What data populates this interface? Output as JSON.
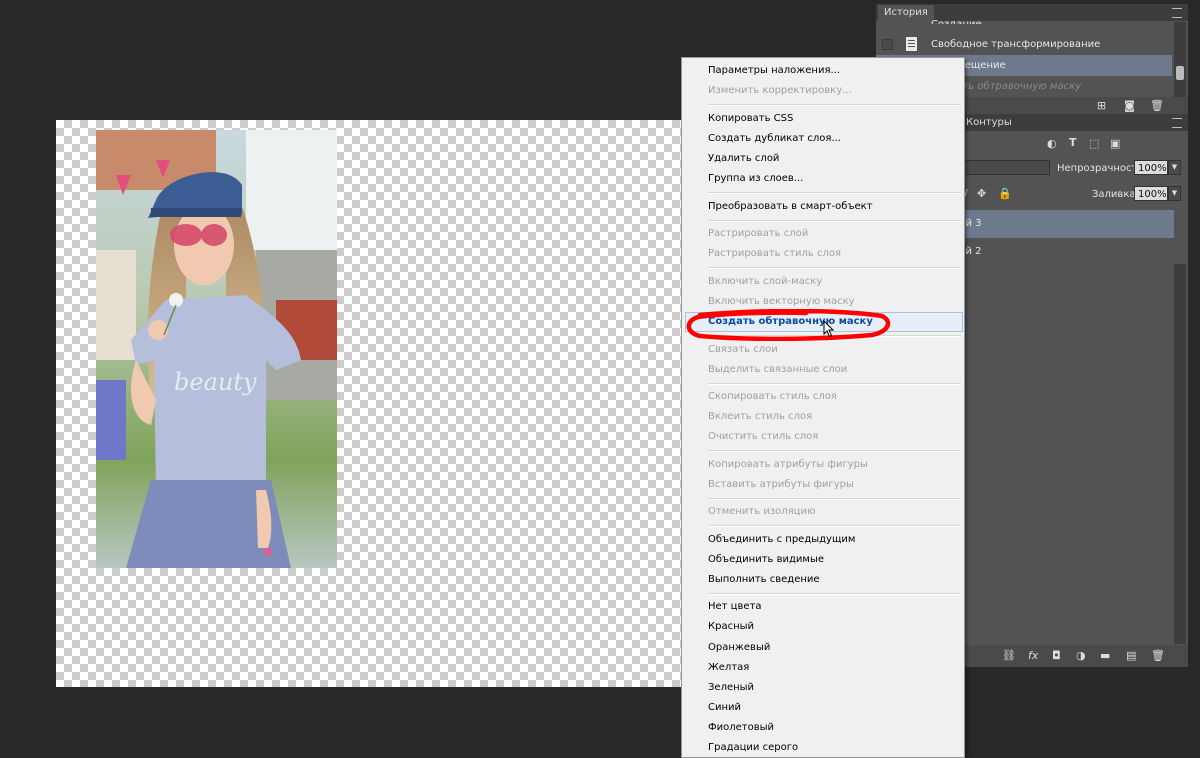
{
  "history": {
    "tab": "История",
    "rows": [
      {
        "label": "Создание"
      },
      {
        "label": "Свободное трансформирование"
      },
      {
        "label": "Перемещение"
      },
      {
        "label": "Создать обтравочную маску"
      }
    ]
  },
  "layers": {
    "tab_paths": "Контуры",
    "opacity_label": "Непрозрачность:",
    "opacity_value": "100%",
    "fill_label": "Заливка:",
    "fill_value": "100%",
    "items": [
      {
        "label": "Слой 3"
      },
      {
        "label": "Слой 2"
      }
    ]
  },
  "menu": {
    "items": [
      {
        "label": "Параметры наложения...",
        "enabled": true
      },
      {
        "label": "Изменить корректировку...",
        "enabled": false
      },
      {
        "label": "Копировать CSS",
        "enabled": true
      },
      {
        "label": "Создать дубликат слоя...",
        "enabled": true
      },
      {
        "label": "Удалить слой",
        "enabled": true
      },
      {
        "label": "Группа из слоев...",
        "enabled": true
      },
      {
        "label": "Преобразовать в смарт-объект",
        "enabled": true
      },
      {
        "label": "Растрировать слой",
        "enabled": false
      },
      {
        "label": "Растрировать стиль слоя",
        "enabled": false
      },
      {
        "label": "Включить слой-маску",
        "enabled": false
      },
      {
        "label": "Включить векторную маску",
        "enabled": false
      },
      {
        "label": "Создать обтравочную маску",
        "enabled": true,
        "highlighted": true
      },
      {
        "label": "Связать слои",
        "enabled": false
      },
      {
        "label": "Выделить связанные слои",
        "enabled": false
      },
      {
        "label": "Скопировать стиль слоя",
        "enabled": false
      },
      {
        "label": "Вклеить стиль слоя",
        "enabled": false
      },
      {
        "label": "Очистить стиль слоя",
        "enabled": false
      },
      {
        "label": "Копировать атрибуты фигуры",
        "enabled": false
      },
      {
        "label": "Вставить атрибуты фигуры",
        "enabled": false
      },
      {
        "label": "Отменить изоляцию",
        "enabled": false
      },
      {
        "label": "Объединить с предыдущим",
        "enabled": true
      },
      {
        "label": "Объединить видимые",
        "enabled": true
      },
      {
        "label": "Выполнить сведение",
        "enabled": true
      },
      {
        "label": "Нет цвета",
        "enabled": true
      },
      {
        "label": "Красный",
        "enabled": true
      },
      {
        "label": "Оранжевый",
        "enabled": true
      },
      {
        "label": "Желтая",
        "enabled": true
      },
      {
        "label": "Зеленый",
        "enabled": true
      },
      {
        "label": "Синий",
        "enabled": true
      },
      {
        "label": "Фиолетовый",
        "enabled": true
      },
      {
        "label": "Градации серого",
        "enabled": true
      }
    ]
  },
  "photo": {
    "shirt_text": "beauty"
  },
  "colors": {
    "workspace": "#282828",
    "panel": "#535353",
    "menu_bg": "#f0f0f0",
    "selected_layer": "#6e7a8c",
    "highlight_mark": "#ff0000"
  }
}
